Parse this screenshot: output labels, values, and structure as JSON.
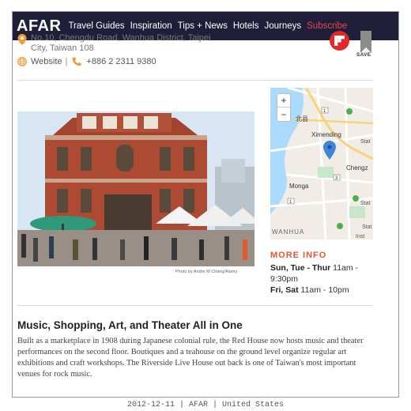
{
  "nav": {
    "logo": "AFAR",
    "links": [
      "Travel Guides",
      "Inspiration",
      "Tips + News",
      "Hotels",
      "Journeys"
    ],
    "subscribe": "Subscribe"
  },
  "place": {
    "address": "No.10, Chengdu Road, Wanhua District, Taipei City, Taiwan 108",
    "website": "Website",
    "separator": "|",
    "phone": "+886 2 2311 9380"
  },
  "actions": {
    "save_label": "SAVE"
  },
  "photo": {
    "credit": "Photo by Andre M Chang/Alamy"
  },
  "map": {
    "labels": [
      "北县",
      "Ximending",
      "Chengz",
      "Monga",
      "WANHUA",
      "Stat",
      "Stat",
      "Inst",
      "Stat"
    ],
    "road_badges": [
      "1",
      "1",
      "3"
    ],
    "zoom_in": "+",
    "zoom_out": "−"
  },
  "info": {
    "heading": "MORE INFO",
    "hours": [
      {
        "days": "Sun, Tue - Thur",
        "time": "11am - 9:30pm"
      },
      {
        "days": "Fri, Sat",
        "time": "11am - 10pm"
      }
    ]
  },
  "article": {
    "title": "Music, Shopping, Art, and Theater All in One",
    "body": "Built as a marketplace in 1908 during Japanese colonial rule, the Red House now hosts music and theater performances on the second floor. Boutiques and a teahouse on the ground level organize regular art exhibitions and craft workshops. The Riverside Live House out back is one of Taiwan's most important venues for rock music."
  },
  "footer": {
    "text": "2012-12-11 | AFAR | United States"
  },
  "colors": {
    "navbar": "#1f1f3a",
    "subscribe": "#e8474c",
    "accent_orange": "#f39a36",
    "more_info": "#e8572f",
    "flipboard_red": "#e12828",
    "map_pin": "#3f86d9"
  },
  "icons": [
    "map-pin-icon",
    "globe-icon",
    "phone-icon",
    "flipboard-icon",
    "bookmark-icon",
    "map-marker-icon"
  ]
}
